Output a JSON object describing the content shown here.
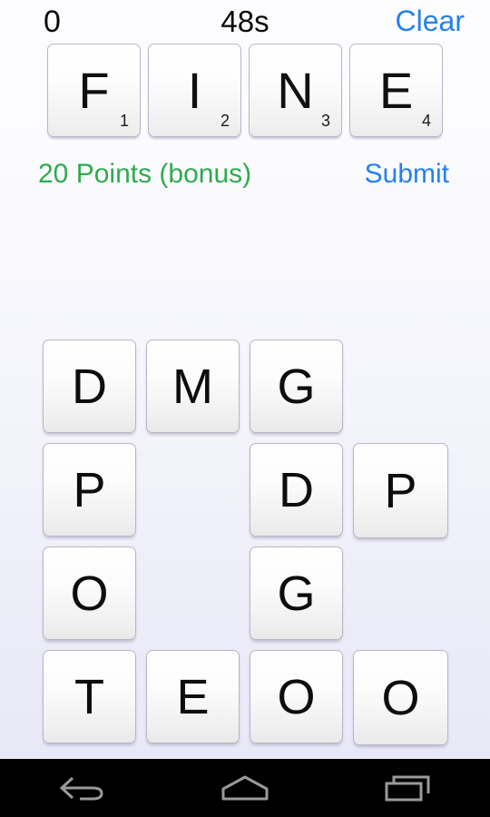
{
  "app": {
    "name": "word-game"
  },
  "header": {
    "score": "0",
    "timer": "48s",
    "clear_label": "Clear"
  },
  "word": {
    "tiles": [
      {
        "letter": "F",
        "index": "1"
      },
      {
        "letter": "I",
        "index": "2"
      },
      {
        "letter": "N",
        "index": "3"
      },
      {
        "letter": "E",
        "index": "4"
      }
    ]
  },
  "status": {
    "points_label": "20 Points (bonus)",
    "points_color": "#2fab4f",
    "submit_label": "Submit",
    "submit_color": "#2680eb"
  },
  "grid": {
    "rows": [
      [
        {
          "letter": "D"
        },
        {
          "letter": "M"
        },
        {
          "letter": "G"
        },
        {
          "letter": ""
        }
      ],
      [
        {
          "letter": "P"
        },
        {
          "letter": ""
        },
        {
          "letter": "D"
        },
        {
          "letter": "P"
        }
      ],
      [
        {
          "letter": "O"
        },
        {
          "letter": ""
        },
        {
          "letter": "G"
        },
        {
          "letter": ""
        }
      ],
      [
        {
          "letter": "T"
        },
        {
          "letter": "E"
        },
        {
          "letter": "O"
        },
        {
          "letter": "O"
        }
      ]
    ]
  },
  "navbar": {
    "back_icon": "back-arrow-icon",
    "home_icon": "home-icon",
    "recents_icon": "recents-icon"
  }
}
